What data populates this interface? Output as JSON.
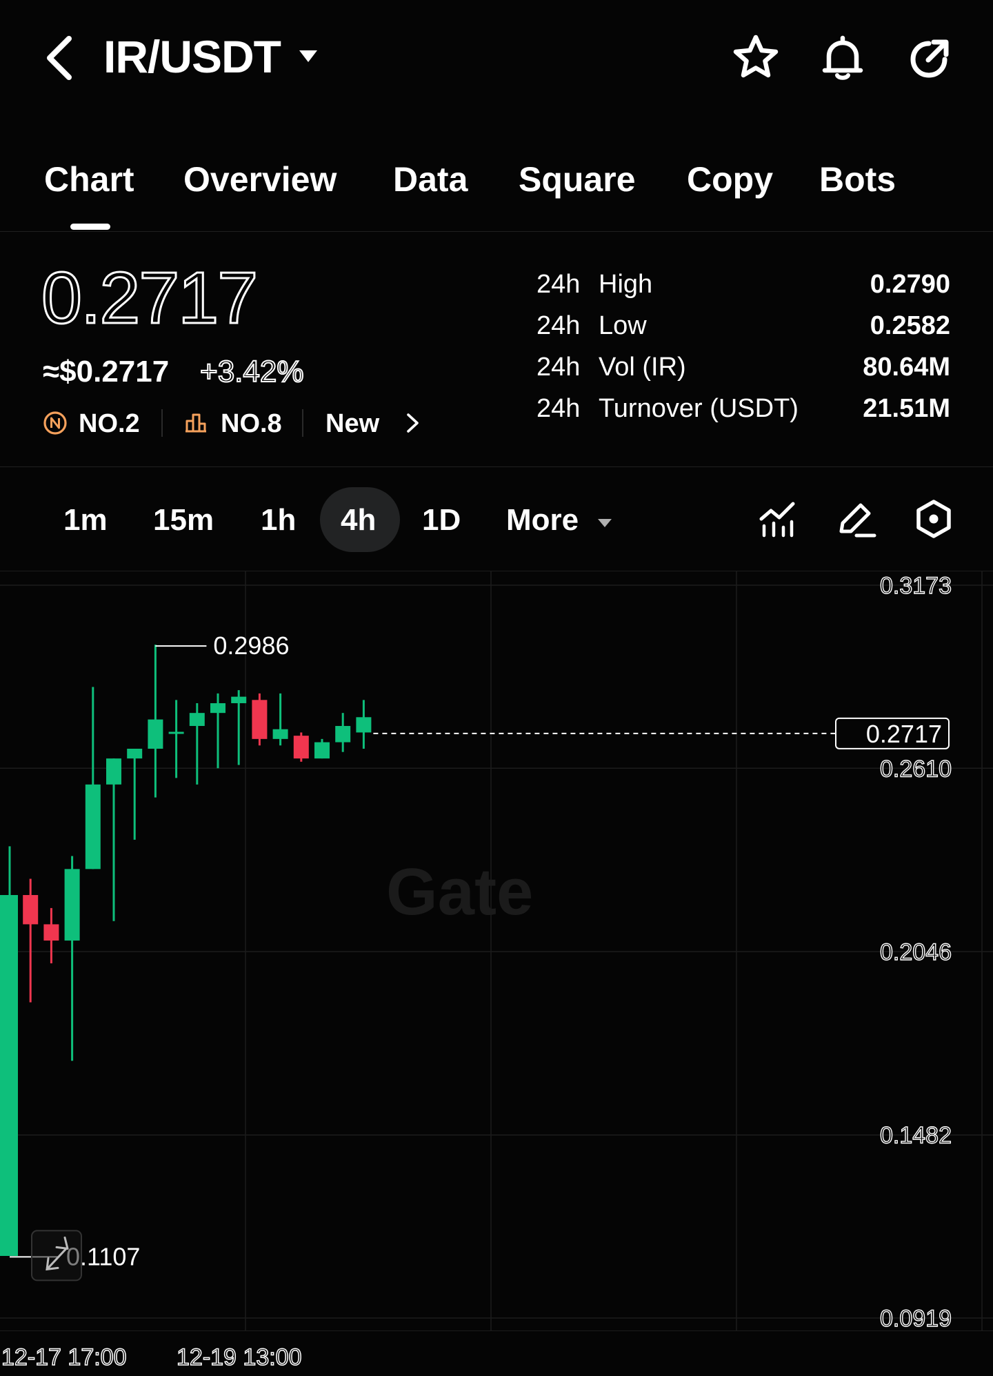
{
  "header": {
    "pair": "IR/USDT",
    "icons": [
      "back-chevron-icon",
      "caret-down-icon",
      "star-icon",
      "bell-icon",
      "share-icon"
    ]
  },
  "tabs": [
    {
      "label": "Chart",
      "active": true
    },
    {
      "label": "Overview"
    },
    {
      "label": "Data"
    },
    {
      "label": "Square"
    },
    {
      "label": "Copy"
    },
    {
      "label": "Bots"
    }
  ],
  "price": {
    "last": "0.2717",
    "usd": "≈$0.2717",
    "change": "+3.42%"
  },
  "ranks": {
    "rank1": "NO.2",
    "rank2": "NO.8",
    "new_label": "New"
  },
  "stats": [
    {
      "prefix": "24h",
      "label": "High",
      "value": "0.2790"
    },
    {
      "prefix": "24h",
      "label": "Low",
      "value": "0.2582"
    },
    {
      "prefix": "24h",
      "label": "Vol (IR)",
      "value": "80.64M"
    },
    {
      "prefix": "24h",
      "label": "Turnover (USDT)",
      "value": "21.51M"
    }
  ],
  "intervals": [
    "1m",
    "15m",
    "1h",
    "4h",
    "1D"
  ],
  "active_interval": "4h",
  "more_label": "More",
  "colors": {
    "up": "#0ebf7b",
    "down": "#f0364f",
    "background": "#050505"
  },
  "chart_data": {
    "type": "candlestick",
    "y_axis_labels": [
      "0.3173",
      "0.2610",
      "0.2046",
      "0.1482",
      "0.0919"
    ],
    "ylim": [
      0.0919,
      0.3173
    ],
    "x_axis_labels": [
      "12-17 17:00",
      "12-19 13:00"
    ],
    "watermark": "Gate",
    "annotations": {
      "high": "0.2986",
      "low": "0.1107",
      "last": "0.2717"
    },
    "candles": [
      {
        "o": 0.111,
        "h": 0.237,
        "l": 0.111,
        "c": 0.222
      },
      {
        "o": 0.222,
        "h": 0.227,
        "l": 0.189,
        "c": 0.213
      },
      {
        "o": 0.213,
        "h": 0.218,
        "l": 0.201,
        "c": 0.208
      },
      {
        "o": 0.208,
        "h": 0.234,
        "l": 0.171,
        "c": 0.23
      },
      {
        "o": 0.23,
        "h": 0.286,
        "l": 0.23,
        "c": 0.256
      },
      {
        "o": 0.256,
        "h": 0.255,
        "l": 0.214,
        "c": 0.264
      },
      {
        "o": 0.264,
        "h": 0.267,
        "l": 0.239,
        "c": 0.267
      },
      {
        "o": 0.267,
        "h": 0.299,
        "l": 0.252,
        "c": 0.276
      },
      {
        "o": 0.2716,
        "h": 0.282,
        "l": 0.258,
        "c": 0.2722
      },
      {
        "o": 0.274,
        "h": 0.281,
        "l": 0.256,
        "c": 0.278
      },
      {
        "o": 0.278,
        "h": 0.284,
        "l": 0.261,
        "c": 0.281
      },
      {
        "o": 0.281,
        "h": 0.285,
        "l": 0.262,
        "c": 0.283
      },
      {
        "o": 0.282,
        "h": 0.284,
        "l": 0.268,
        "c": 0.27
      },
      {
        "o": 0.27,
        "h": 0.284,
        "l": 0.268,
        "c": 0.273
      },
      {
        "o": 0.271,
        "h": 0.272,
        "l": 0.263,
        "c": 0.264
      },
      {
        "o": 0.264,
        "h": 0.27,
        "l": 0.264,
        "c": 0.269
      },
      {
        "o": 0.269,
        "h": 0.278,
        "l": 0.266,
        "c": 0.274
      },
      {
        "o": 0.272,
        "h": 0.282,
        "l": 0.267,
        "c": 0.2767
      }
    ]
  }
}
